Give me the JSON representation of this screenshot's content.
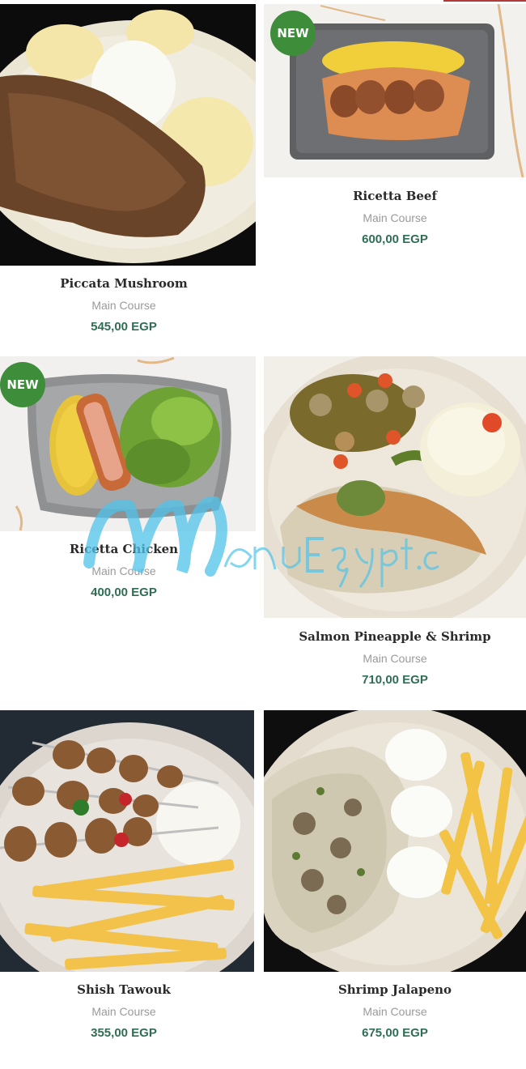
{
  "badges": {
    "new": "NEW"
  },
  "items": [
    {
      "name": "Piccata Mushroom",
      "category": "Main Course",
      "price": "545,00 EGP",
      "badge": ""
    },
    {
      "name": "Ricetta Beef",
      "category": "Main Course",
      "price": "600,00 EGP",
      "badge": "NEW"
    },
    {
      "name": "Ricetta Chicken",
      "category": "Main Course",
      "price": "400,00 EGP",
      "badge": "NEW"
    },
    {
      "name": "Salmon Pineapple & Shrimp",
      "category": "Main Course",
      "price": "710,00 EGP",
      "badge": ""
    },
    {
      "name": "Shish Tawouk",
      "category": "Main Course",
      "price": "355,00 EGP",
      "badge": ""
    },
    {
      "name": "Shrimp Jalapeno",
      "category": "Main Course",
      "price": "675,00 EGP",
      "badge": ""
    }
  ],
  "watermark": {
    "text": "MenuEgypt.com"
  },
  "colors": {
    "accent": "#2f6e55",
    "badge": "#3d8d3a",
    "muted": "#9a9a9a",
    "title": "#2a2a2a"
  }
}
